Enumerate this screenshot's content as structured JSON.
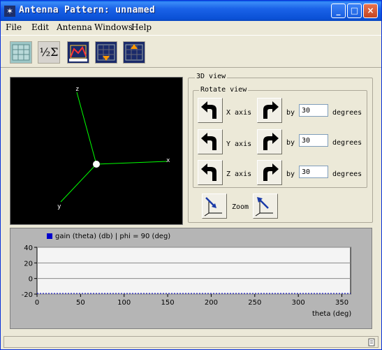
{
  "window": {
    "title": "Antenna Pattern: unnamed",
    "icon": "star-icon"
  },
  "title_buttons": {
    "minimize": "_",
    "maximize": "□",
    "close": "×"
  },
  "menu": [
    "File",
    "Edit",
    "Antenna",
    "Windows",
    "Help"
  ],
  "toolbar": {
    "tools": [
      "grid-table-icon",
      "half-sigma-icon",
      "polar-plot-icon",
      "down-triangle-plot-icon",
      "up-triangle-plot-icon"
    ],
    "half_sigma_label": "½Σ"
  },
  "view3d": {
    "axis_labels": {
      "x": "x",
      "y": "y",
      "z": "z"
    },
    "background": "#000000",
    "axis_color": "#00ff00"
  },
  "panel3d": {
    "title": "3D view",
    "rotate_title": "Rotate view",
    "rows": [
      {
        "axis_label": "X axis",
        "by": "by",
        "value": "30",
        "unit": "degrees"
      },
      {
        "axis_label": "Y axis",
        "by": "by",
        "value": "30",
        "unit": "degrees"
      },
      {
        "axis_label": "Z axis",
        "by": "by",
        "value": "30",
        "unit": "degrees"
      }
    ],
    "zoom_label": "Zoom"
  },
  "chart_data": {
    "type": "line",
    "legend": "gain (theta) (db) | phi = 90 (deg)",
    "xlabel": "theta (deg)",
    "ylabel": "",
    "xlim": [
      0,
      360
    ],
    "ylim": [
      -20,
      40
    ],
    "xticks": [
      0,
      50,
      100,
      150,
      200,
      250,
      300,
      350
    ],
    "yticks": [
      40,
      20,
      0,
      -20
    ],
    "grid": true,
    "series": [
      {
        "name": "gain (theta) (db) | phi = 90 (deg)",
        "color": "#0000cc",
        "x": [
          0,
          90,
          180,
          270,
          360
        ],
        "y": [
          -20,
          -20,
          -20,
          -20,
          -20
        ]
      }
    ]
  }
}
